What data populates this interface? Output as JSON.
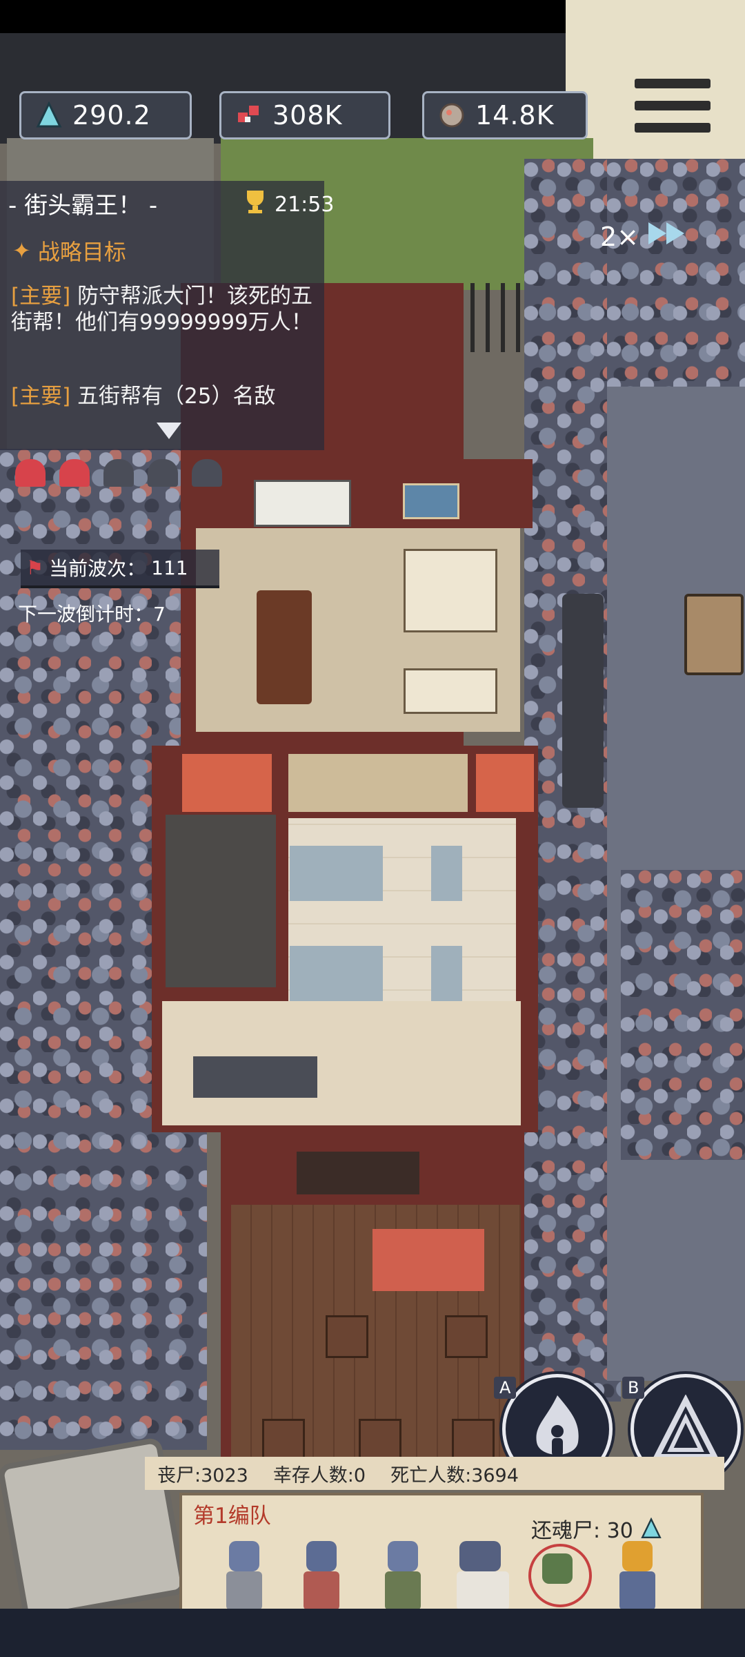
{
  "hud": {
    "resources": [
      {
        "icon": "crystal-icon",
        "value": "290.2"
      },
      {
        "icon": "gem-icon",
        "value": "308K"
      },
      {
        "icon": "ore-icon",
        "value": "14.8K"
      }
    ],
    "speed": "2×"
  },
  "quest": {
    "title": "- 街头霸王！ -",
    "timer": "21:53",
    "strategy_label": "战略目标",
    "objectives": [
      {
        "tag": "[主要]",
        "text": "防守帮派大门！该死的五街帮！他们有99999999万人！"
      },
      {
        "tag": "[主要]",
        "text": "五街帮有（25）名敌"
      }
    ]
  },
  "wave": {
    "current_label": "当前波次：",
    "current_value": "111",
    "countdown_label": "下一波倒计时：",
    "countdown_value": "7"
  },
  "stats": {
    "zombies": "丧尸:3023",
    "survivors": "幸存人数:0",
    "dead": "死亡人数:3694"
  },
  "squad": {
    "name": "第1编队",
    "revive_label": "还魂尸: 30"
  },
  "skills": [
    {
      "key": "A",
      "icon": "flame-figure-icon"
    },
    {
      "key": "B",
      "icon": "triangle-icon"
    }
  ],
  "colors": {
    "accent_orange": "#e8a040",
    "wall_red": "#6d2f2a",
    "road_blue": "#6d7282",
    "squad_red": "#b33a2a"
  }
}
